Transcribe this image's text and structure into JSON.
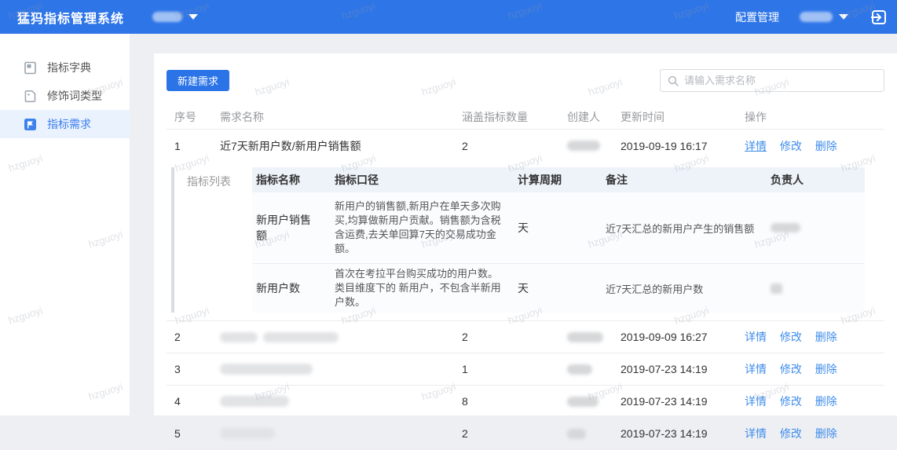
{
  "watermark": {
    "text": "hzguoyi"
  },
  "header": {
    "title": "猛犸指标管理系统",
    "config_label": "配置管理"
  },
  "sidebar": {
    "items": [
      {
        "label": "指标字典"
      },
      {
        "label": "修饰词类型"
      },
      {
        "label": "指标需求"
      }
    ]
  },
  "toolbar": {
    "new_button": "新建需求",
    "search_placeholder": "请输入需求名称"
  },
  "table": {
    "columns": [
      "序号",
      "需求名称",
      "涵盖指标数量",
      "创建人",
      "更新时间",
      "操作"
    ],
    "actions": [
      "详情",
      "修改",
      "删除"
    ],
    "rows": [
      {
        "seq": "1",
        "name": "近7天新用户数/新用户销售额",
        "count": "2",
        "updated": "2019-09-19 16:17"
      },
      {
        "seq": "2",
        "name": "",
        "count": "2",
        "updated": "2019-09-09 16:27"
      },
      {
        "seq": "3",
        "name": "",
        "count": "1",
        "updated": "2019-07-23 14:19"
      },
      {
        "seq": "4",
        "name": "",
        "count": "8",
        "updated": "2019-07-23 14:19"
      },
      {
        "seq": "5",
        "name": "",
        "count": "2",
        "updated": "2019-07-23 14:19"
      }
    ]
  },
  "subtable": {
    "label": "指标列表",
    "columns": [
      "指标名称",
      "指标口径",
      "计算周期",
      "备注",
      "负责人"
    ],
    "rows": [
      {
        "name": "新用户销售额",
        "caliber": "新用户的销售额,新用户在单天多次购买,均算做新用户贡献。销售额为含税含运费,去关单回算7天的交易成功金额。",
        "period": "天",
        "remark": "近7天汇总的新用户产生的销售额"
      },
      {
        "name": "新用户数",
        "caliber": "首次在考拉平台购买成功的用户数。类目维度下的 新用户，不包含半新用户数。",
        "period": "天",
        "remark": "近7天汇总的新用户数"
      }
    ]
  },
  "colors": {
    "header_blue": "#2e75e7",
    "button_blue": "#2b74e8",
    "link_blue": "#3f8cea",
    "active_item_bg": "#eaf2fd",
    "subhead_bg": "#edf3f9"
  }
}
